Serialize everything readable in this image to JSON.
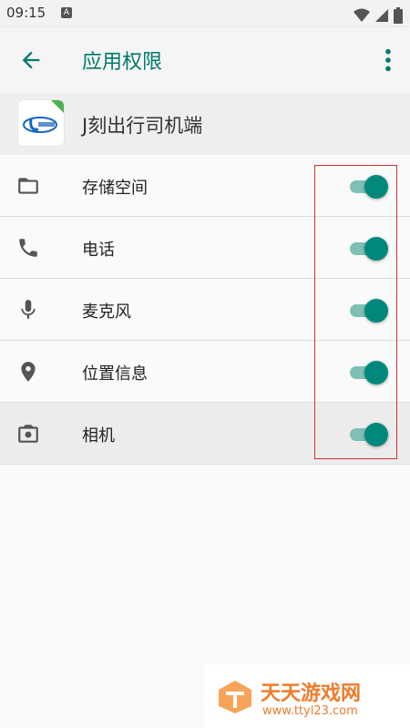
{
  "status_bar": {
    "time": "09:15",
    "notification_letter": "A"
  },
  "app_bar": {
    "title": "应用权限",
    "back_icon": "arrow-back-icon",
    "menu_icon": "more-vert-icon"
  },
  "app": {
    "name": "J刻出行司机端",
    "icon": "app-logo-icon"
  },
  "permissions": [
    {
      "label": "存储空间",
      "icon": "folder-icon",
      "enabled": true
    },
    {
      "label": "电话",
      "icon": "phone-icon",
      "enabled": true
    },
    {
      "label": "麦克风",
      "icon": "microphone-icon",
      "enabled": true
    },
    {
      "label": "位置信息",
      "icon": "location-pin-icon",
      "enabled": true
    },
    {
      "label": "相机",
      "icon": "camera-icon",
      "enabled": true
    }
  ],
  "watermark": {
    "title": "天天游戏网",
    "url": "www.ttyl23.com"
  },
  "colors": {
    "accent": "#00796b",
    "toggle_thumb": "#00897b",
    "toggle_track": "#7fbfb5",
    "annotation": "#d32f2f"
  }
}
